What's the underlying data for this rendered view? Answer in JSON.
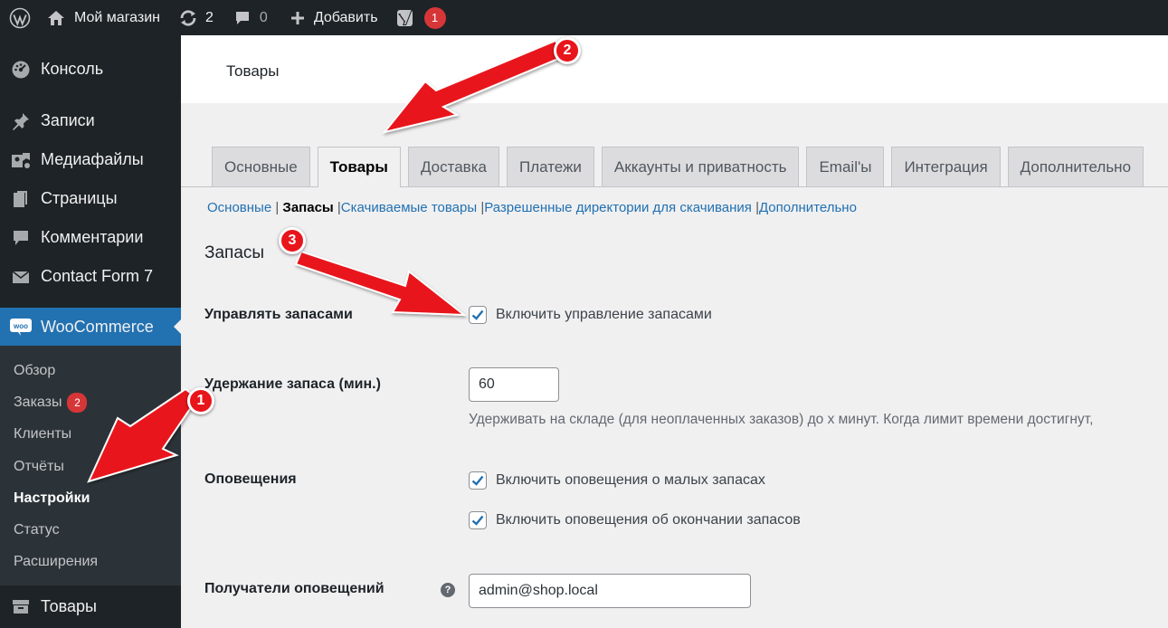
{
  "adminbar": {
    "site_name": "Мой магазин",
    "updates_count": "2",
    "comments_count": "0",
    "add_label": "Добавить",
    "yoast_badge": "1"
  },
  "sidebar": {
    "console": "Консоль",
    "posts": "Записи",
    "media": "Медиафайлы",
    "pages": "Страницы",
    "comments": "Комментарии",
    "contact_form": "Contact Form 7",
    "woocommerce": "WooCommerce",
    "woo_submenu": {
      "overview": "Обзор",
      "orders": "Заказы",
      "orders_badge": "2",
      "customers": "Клиенты",
      "reports": "Отчёты",
      "settings": "Настройки",
      "status": "Статус",
      "extensions": "Расширения"
    },
    "products": "Товары"
  },
  "page": {
    "title": "Товары"
  },
  "tabs": [
    "Основные",
    "Товары",
    "Доставка",
    "Платежи",
    "Аккаунты и приватность",
    "Email'ы",
    "Интеграция",
    "Дополнительно"
  ],
  "subsections": {
    "general": "Основные",
    "sep1": " |",
    "inventory": "Запасы",
    "sep2": " |",
    "downloadable": "Скачиваемые товары",
    "sep3": " |",
    "download_dirs": "Разрешенные директории для скачивания",
    "sep4": " |",
    "advanced": "Дополнительно"
  },
  "form": {
    "section_title": "Запасы",
    "manage_stock_label": "Управлять запасами",
    "manage_stock_checkbox": "Включить управление запасами",
    "hold_stock_label": "Удержание запаса (мин.)",
    "hold_stock_value": "60",
    "hold_stock_desc": "Удерживать на складе (для неоплаченных заказов) до x минут. Когда лимит времени достигнут,",
    "notifications_label": "Оповещения",
    "low_stock_checkbox": "Включить оповещения о малых запасах",
    "out_of_stock_checkbox": "Включить оповещения об окончании запасов",
    "recipient_label": "Получатели оповещений",
    "recipient_value": "admin@shop.local",
    "help_glyph": "?"
  },
  "annotations": {
    "badge1": "1",
    "badge2": "2",
    "badge3": "3",
    "arrow_color": "#e8151b"
  }
}
